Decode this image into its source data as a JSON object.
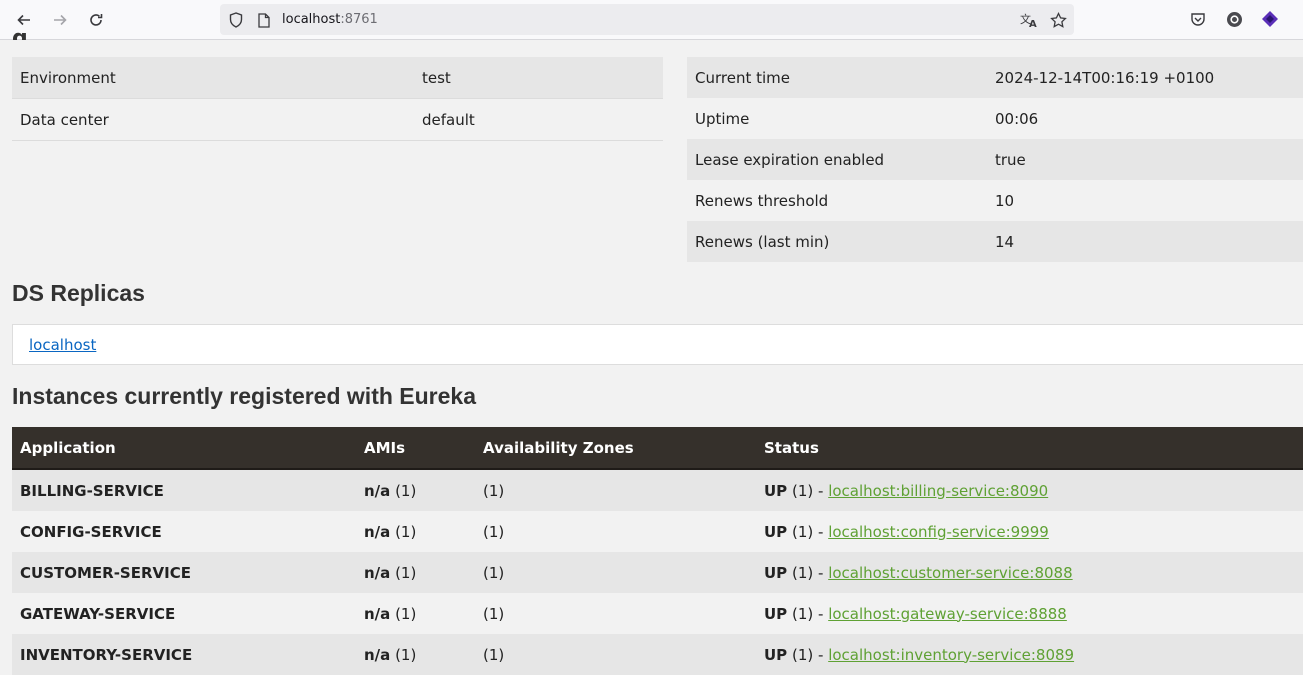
{
  "browser": {
    "url_host": "localhost",
    "url_port": ":8761",
    "icons": {
      "back": "arrow-left-icon",
      "forward": "arrow-right-icon",
      "reload": "reload-icon",
      "shield": "shield-icon",
      "page": "page-icon",
      "translate": "translate-icon",
      "bookmark": "star-icon",
      "pocket": "pocket-icon",
      "extension1": "circle-o-icon",
      "extension2": "purple-diamond-icon"
    }
  },
  "general_info": {
    "left": [
      {
        "key": "Environment",
        "value": "test"
      },
      {
        "key": "Data center",
        "value": "default"
      }
    ],
    "right": [
      {
        "key": "Current time",
        "value": "2024-12-14T00:16:19 +0100"
      },
      {
        "key": "Uptime",
        "value": "00:06"
      },
      {
        "key": "Lease expiration enabled",
        "value": "true"
      },
      {
        "key": "Renews threshold",
        "value": "10"
      },
      {
        "key": "Renews (last min)",
        "value": "14"
      }
    ]
  },
  "replicas": {
    "title": "DS Replicas",
    "link": "localhost"
  },
  "instances": {
    "title": "Instances currently registered with Eureka",
    "columns": [
      "Application",
      "AMIs",
      "Availability Zones",
      "Status"
    ],
    "rows": [
      {
        "application": "BILLING-SERVICE",
        "ami": "n/a",
        "ami_count": "(1)",
        "zones": "(1)",
        "status": "UP",
        "status_count": "(1) -",
        "instance": "localhost:billing-service:8090"
      },
      {
        "application": "CONFIG-SERVICE",
        "ami": "n/a",
        "ami_count": "(1)",
        "zones": "(1)",
        "status": "UP",
        "status_count": "(1) -",
        "instance": "localhost:config-service:9999"
      },
      {
        "application": "CUSTOMER-SERVICE",
        "ami": "n/a",
        "ami_count": "(1)",
        "zones": "(1)",
        "status": "UP",
        "status_count": "(1) -",
        "instance": "localhost:customer-service:8088"
      },
      {
        "application": "GATEWAY-SERVICE",
        "ami": "n/a",
        "ami_count": "(1)",
        "zones": "(1)",
        "status": "UP",
        "status_count": "(1) -",
        "instance": "localhost:gateway-service:8888"
      },
      {
        "application": "INVENTORY-SERVICE",
        "ami": "n/a",
        "ami_count": "(1)",
        "zones": "(1)",
        "status": "UP",
        "status_count": "(1) -",
        "instance": "localhost:inventory-service:8089"
      }
    ]
  },
  "colors": {
    "header_bg": "#35302b",
    "link_green": "#5fa134",
    "link_blue": "#0a66c2",
    "row_shade": "#e6e6e6",
    "page_bg": "#f2f2f2"
  }
}
